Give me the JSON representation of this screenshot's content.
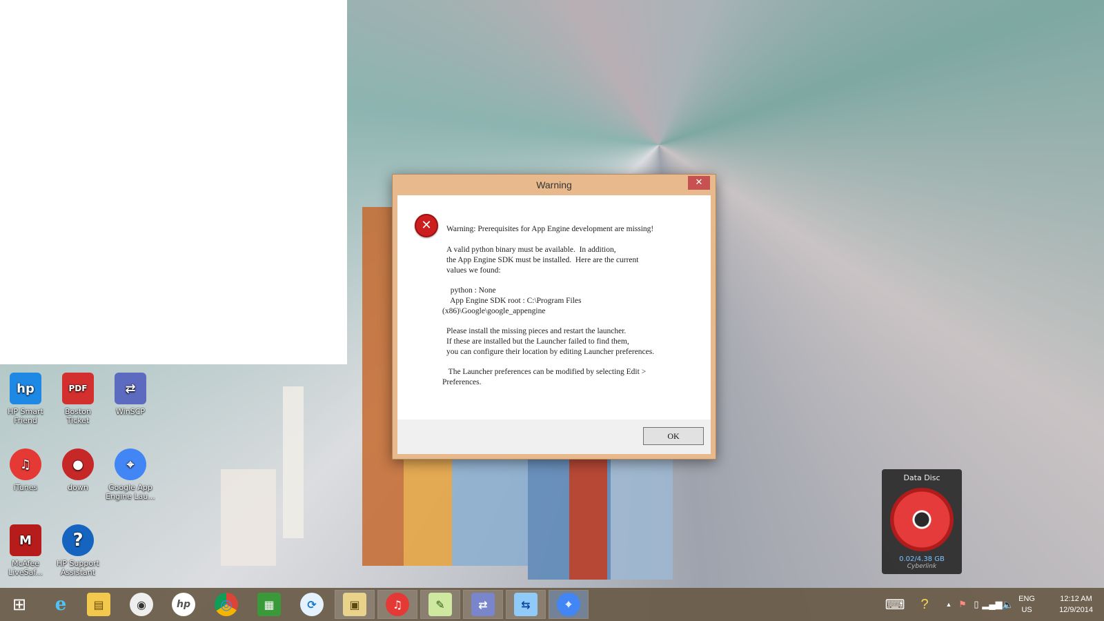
{
  "desktop": {
    "icons": [
      {
        "label": "HP Smart Friend",
        "icon": "hp-smart-friend-icon",
        "color": "#1e88e5"
      },
      {
        "label": "Boston Ticket",
        "icon": "pdf-icon",
        "color": "#d32f2f"
      },
      {
        "label": "WinSCP",
        "icon": "winscp-icon",
        "color": "#5c6bc0"
      },
      {
        "label": "iTunes",
        "icon": "itunes-icon",
        "color": "#e53935"
      },
      {
        "label": "down",
        "icon": "red-disc-icon",
        "color": "#c62828"
      },
      {
        "label": "Google App Engine Lau...",
        "icon": "app-engine-icon",
        "color": "#4285f4"
      },
      {
        "label": "McAfee LiveSaf...",
        "icon": "mcafee-icon",
        "color": "#b71c1c"
      },
      {
        "label": "HP Support Assistant",
        "icon": "hp-support-icon",
        "color": "#1565c0"
      }
    ]
  },
  "dialog": {
    "title": "Warning",
    "close_glyph": "✕",
    "error_glyph": "✕",
    "heading": "Warning: Prerequisites for App Engine development are missing!",
    "para1": "A valid python binary must be available.  In addition,\nthe App Engine SDK must be installed.  Here are the current\nvalues we found:",
    "python_line": "  python : None",
    "sdk_line": "  App Engine SDK root : C:\\Program Files",
    "sdk_line2": "(x86)\\Google\\google_appengine",
    "para2": "Please install the missing pieces and restart the launcher.\nIf these are installed but the Launcher failed to find them,\nyou can configure their location by editing Launcher preferences.",
    "para3": " The Launcher preferences can be modified by selecting Edit >",
    "para3b": "Preferences.",
    "ok_label": "OK"
  },
  "gadget": {
    "title": "Data Disc",
    "size": "0.02/4.38 GB",
    "brand": "Cyberlink"
  },
  "taskbar": {
    "items": [
      {
        "name": "start",
        "glyph": "⊞"
      },
      {
        "name": "internet-explorer",
        "glyph": "e"
      },
      {
        "name": "file-explorer",
        "glyph": "▤"
      },
      {
        "name": "app-blank",
        "glyph": "◉"
      },
      {
        "name": "hp",
        "glyph": "hp"
      },
      {
        "name": "chrome",
        "glyph": "◎"
      },
      {
        "name": "store",
        "glyph": "▦"
      },
      {
        "name": "sync",
        "glyph": "⟳"
      },
      {
        "name": "explorer-folders",
        "glyph": "▣"
      },
      {
        "name": "itunes",
        "glyph": "♫"
      },
      {
        "name": "notepad",
        "glyph": "✎"
      },
      {
        "name": "winscp",
        "glyph": "⇄"
      },
      {
        "name": "network",
        "glyph": "⇆"
      },
      {
        "name": "app-engine",
        "glyph": "⌖"
      }
    ],
    "lang": "ENG",
    "region": "US",
    "time": "12:12 AM",
    "date": "12/9/2014"
  }
}
